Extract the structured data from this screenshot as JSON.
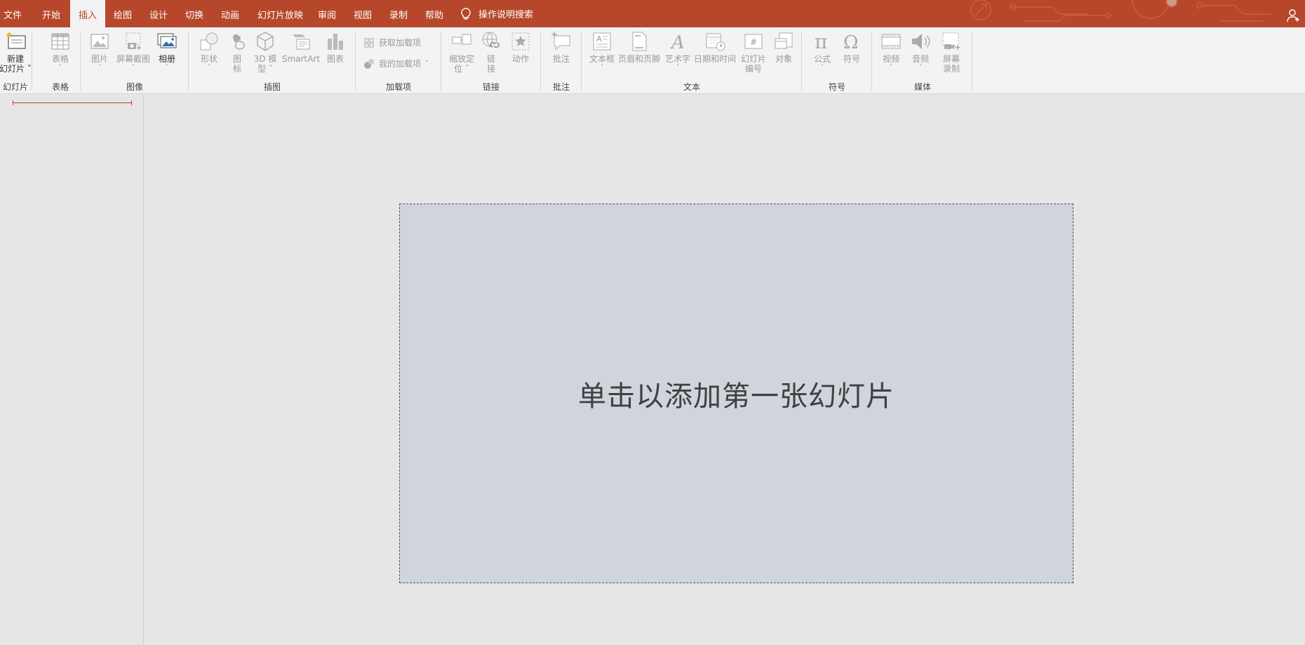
{
  "menu": {
    "tabs": [
      {
        "label": "文件"
      },
      {
        "label": "开始"
      },
      {
        "label": "插入",
        "active": true
      },
      {
        "label": "绘图"
      },
      {
        "label": "设计"
      },
      {
        "label": "切换"
      },
      {
        "label": "动画"
      },
      {
        "label": "幻灯片放映"
      },
      {
        "label": "审阅"
      },
      {
        "label": "视图"
      },
      {
        "label": "录制"
      },
      {
        "label": "帮助"
      }
    ],
    "tell_me": "操作说明搜索",
    "accent": "#b7472a"
  },
  "ribbon": {
    "groups": {
      "slides": "幻灯片",
      "tables": "表格",
      "images": "图像",
      "illustrations": "插图",
      "addins": "加载项",
      "links": "链接",
      "comments": "批注",
      "text": "文本",
      "symbols": "符号",
      "media": "媒体"
    },
    "buttons": {
      "new_slide": [
        "新建",
        "幻灯片 ˅"
      ],
      "table": "表格",
      "picture": "图片",
      "screenshot": "屏幕截图",
      "album": "相册",
      "shapes": "形状",
      "icons": [
        "图",
        "标"
      ],
      "models3d": [
        "3D 模",
        "型 ˅"
      ],
      "smartart": "SmartArt",
      "chart": "图表",
      "get_addins": "获取加载项",
      "my_addins": "我的加载项",
      "zoom": [
        "缩放定",
        "位 ˅"
      ],
      "link": [
        "链",
        "接"
      ],
      "action": "动作",
      "comment": "批注",
      "textbox": "文本框",
      "header_footer": "页眉和页脚",
      "wordart": "艺术字",
      "datetime": "日期和时间",
      "slide_number": [
        "幻灯片",
        "编号"
      ],
      "object": "对象",
      "equation": "公式",
      "symbol": "符号",
      "video": "视频",
      "audio": "音频",
      "screen_recording": [
        "屏幕",
        "录制"
      ]
    }
  },
  "slide": {
    "placeholder": "单击以添加第一张幻灯片"
  }
}
